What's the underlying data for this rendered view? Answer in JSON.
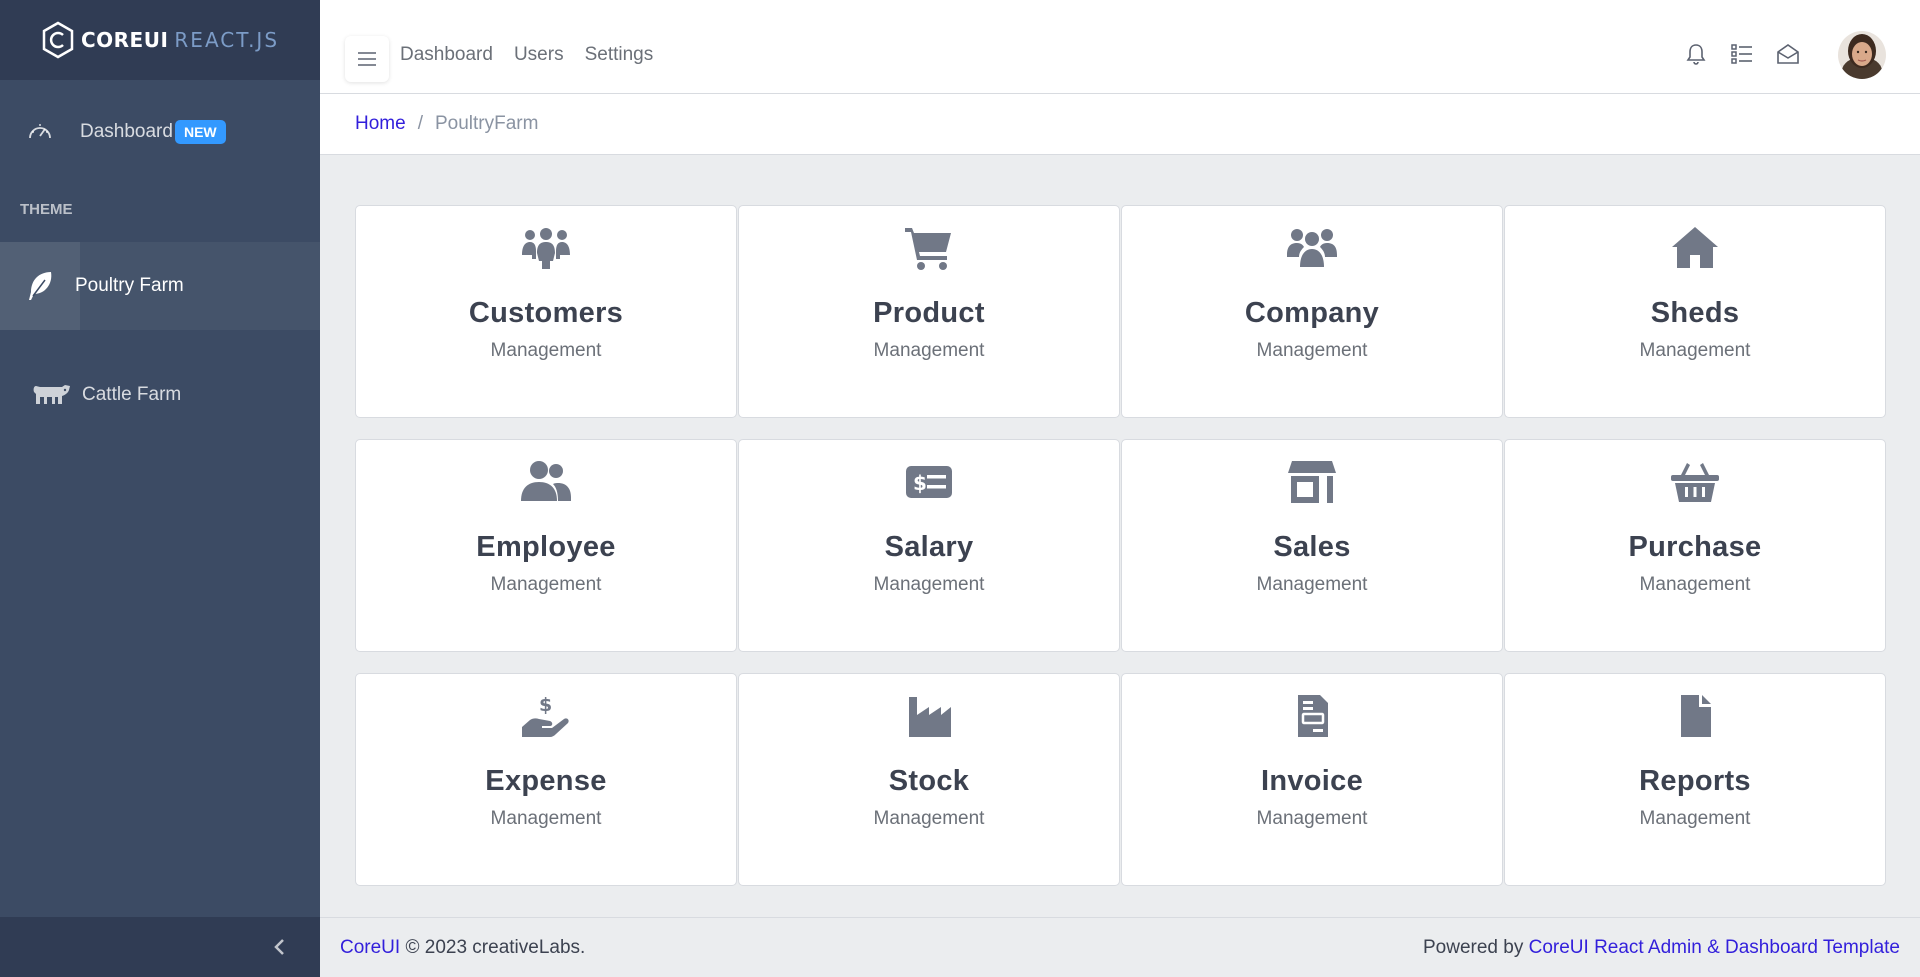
{
  "brand": {
    "core": "COREUI",
    "react": "REACT.JS"
  },
  "sidebar": {
    "dashboard": {
      "label": "Dashboard",
      "badge": "NEW"
    },
    "section_title": "THEME",
    "items": [
      {
        "label": "Poultry Farm",
        "icon": "feather-icon",
        "active": true
      },
      {
        "label": "Cattle Farm",
        "icon": "cow-icon",
        "active": false
      }
    ]
  },
  "header": {
    "nav": [
      "Dashboard",
      "Users",
      "Settings"
    ],
    "icons": [
      "bell-icon",
      "list-icon",
      "envelope-open-icon"
    ]
  },
  "breadcrumb": {
    "home": "Home",
    "separator": "/",
    "current": "PoultryFarm"
  },
  "cards": [
    {
      "title": "Customers",
      "subtitle": "Management",
      "icon": "people-group-icon"
    },
    {
      "title": "Product",
      "subtitle": "Management",
      "icon": "cart-icon"
    },
    {
      "title": "Company",
      "subtitle": "Management",
      "icon": "users-icon"
    },
    {
      "title": "Sheds",
      "subtitle": "Management",
      "icon": "house-icon"
    },
    {
      "title": "Employee",
      "subtitle": "Management",
      "icon": "user-group-icon"
    },
    {
      "title": "Salary",
      "subtitle": "Management",
      "icon": "money-check-icon"
    },
    {
      "title": "Sales",
      "subtitle": "Management",
      "icon": "store-icon"
    },
    {
      "title": "Purchase",
      "subtitle": "Management",
      "icon": "basket-icon"
    },
    {
      "title": "Expense",
      "subtitle": "Management",
      "icon": "hand-dollar-icon"
    },
    {
      "title": "Stock",
      "subtitle": "Management",
      "icon": "industry-icon"
    },
    {
      "title": "Invoice",
      "subtitle": "Management",
      "icon": "invoice-icon"
    },
    {
      "title": "Reports",
      "subtitle": "Management",
      "icon": "file-icon"
    }
  ],
  "footer": {
    "left_link": "CoreUI",
    "left_text": "© 2023 creativeLabs.",
    "right_text": "Powered by",
    "right_link": "CoreUI React Admin & Dashboard Template"
  },
  "colors": {
    "sidebar": "#3c4b64",
    "sidebar_dark": "#303c54",
    "accent": "#321fdb",
    "badge": "#3399ff",
    "icon": "#717887"
  }
}
